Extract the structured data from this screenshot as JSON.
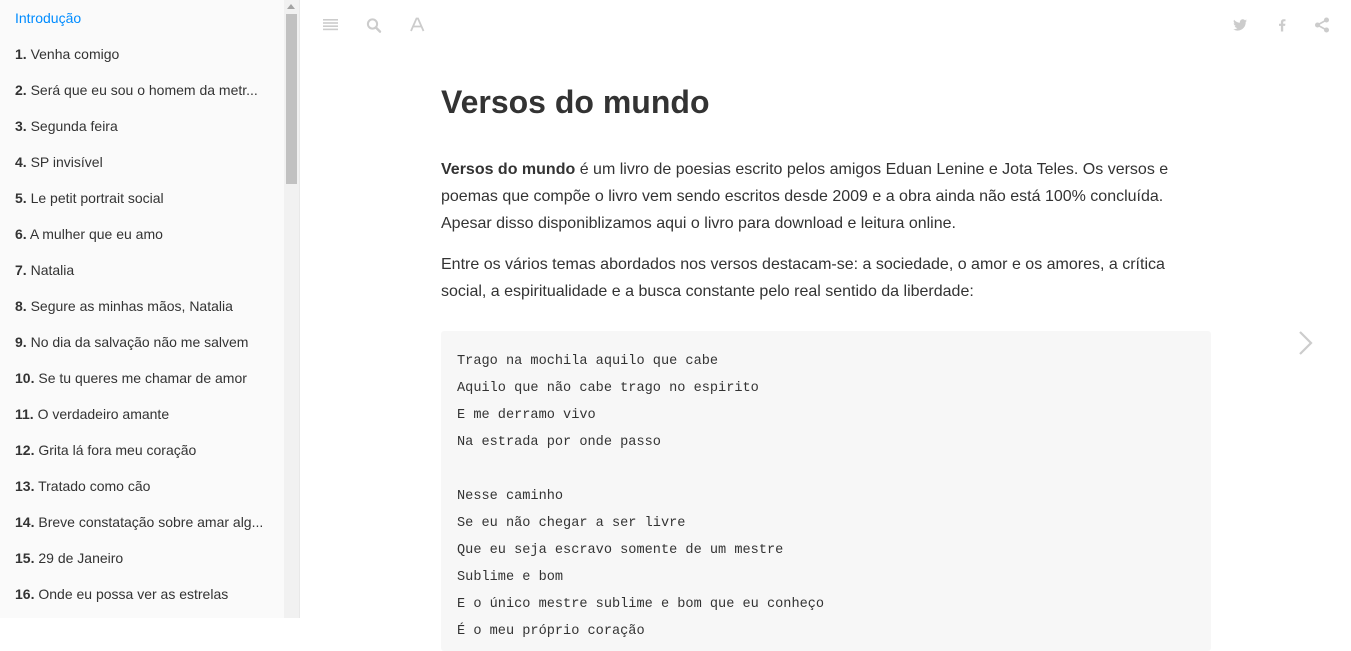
{
  "sidebar": {
    "items": [
      {
        "num": "",
        "label": "Introdução",
        "active": true
      },
      {
        "num": "1.",
        "label": "Venha comigo"
      },
      {
        "num": "2.",
        "label": "Será que eu sou o homem da metr..."
      },
      {
        "num": "3.",
        "label": "Segunda feira"
      },
      {
        "num": "4.",
        "label": "SP invisível"
      },
      {
        "num": "5.",
        "label": "Le petit portrait social"
      },
      {
        "num": "6.",
        "label": "A mulher que eu amo"
      },
      {
        "num": "7.",
        "label": "Natalia"
      },
      {
        "num": "8.",
        "label": "Segure as minhas mãos, Natalia"
      },
      {
        "num": "9.",
        "label": "No dia da salvação não me salvem"
      },
      {
        "num": "10.",
        "label": "Se tu queres me chamar de amor"
      },
      {
        "num": "11.",
        "label": "O verdadeiro amante"
      },
      {
        "num": "12.",
        "label": "Grita lá fora meu coração"
      },
      {
        "num": "13.",
        "label": "Tratado como cão"
      },
      {
        "num": "14.",
        "label": "Breve constatação sobre amar alg..."
      },
      {
        "num": "15.",
        "label": "29 de Janeiro"
      },
      {
        "num": "16.",
        "label": "Onde eu possa ver as estrelas"
      }
    ]
  },
  "header": {
    "left_icons": [
      "menu-icon",
      "search-icon",
      "font-icon"
    ],
    "right_icons": [
      "twitter-icon",
      "facebook-icon",
      "share-icon"
    ]
  },
  "content": {
    "title": "Versos do mundo",
    "intro_bold": "Versos do mundo",
    "intro_rest": " é um livro de poesias escrito pelos amigos Eduan Lenine e Jota Teles. Os versos e poemas que compõe o livro vem sendo escritos desde 2009 e a obra ainda não está 100% concluída. Apesar disso disponiblizamos aqui o livro para download e leitura online.",
    "paragraph2": "Entre os vários temas abordados nos versos destacam-se: a sociedade, o amor e os amores, a crítica social, a espiritualidade e a busca constante pelo real sentido da liberdade:",
    "code_lines": [
      "Trago na mochila aquilo que cabe",
      "Aquilo que não cabe trago no espirito",
      "E me derramo vivo",
      "Na estrada por onde passo",
      "",
      "Nesse caminho",
      "Se eu não chegar a ser livre",
      "Que eu seja escravo somente de um mestre",
      "Sublime e bom",
      "E o único mestre sublime e bom que eu conheço",
      "É o meu próprio coração"
    ]
  },
  "colors": {
    "accent": "#008cff",
    "icon": "#cccccc",
    "sidebar_bg": "#fafafa",
    "code_bg": "#f7f7f7"
  }
}
